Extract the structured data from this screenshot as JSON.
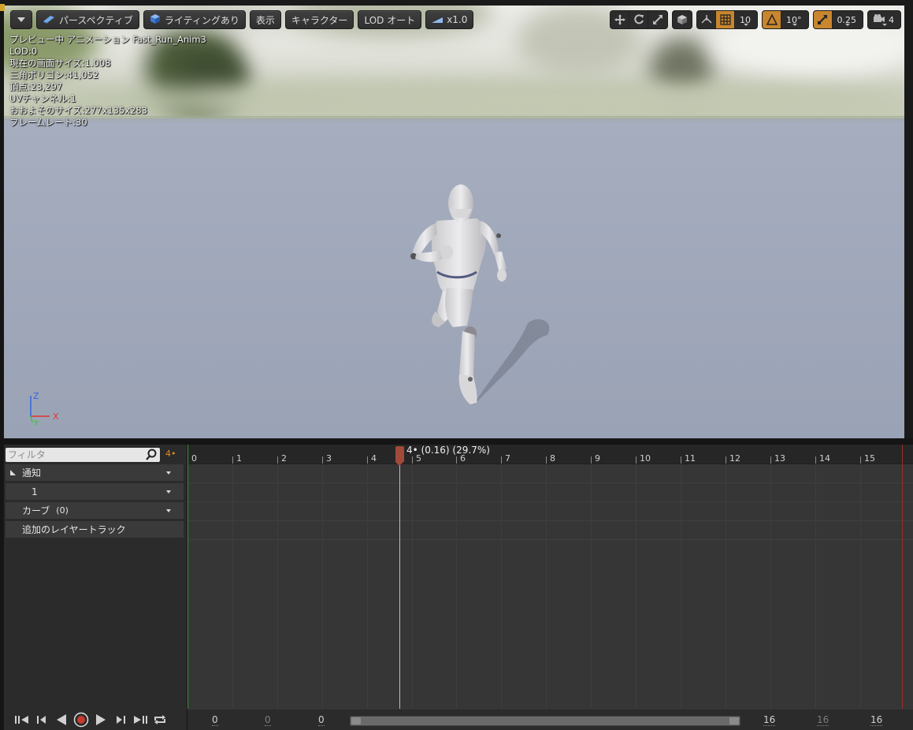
{
  "viewport": {
    "toolbar": {
      "menu_caret": "chevron-down-icon",
      "perspective_label": "パースペクティブ",
      "lighting_label": "ライティングあり",
      "show_label": "表示",
      "character_label": "キャラクター",
      "lod_label": "LOD オート",
      "speed_label": "x1.0"
    },
    "toolbar_right": {
      "grid_snap_value": "10",
      "rotate_snap_value": "10°",
      "scale_snap_value": "0.25",
      "camera_speed_value": "4"
    },
    "stats": [
      "プレビュー中 アニメーション Fast_Run_Anim3",
      "LOD:0",
      "現在の画面サイズ:1.008",
      "三角ポリゴン:41,052",
      "頂点:23,297",
      "UVチャンネル:1",
      "おおよそのサイズ:277x135x283",
      "フレームレート:30"
    ],
    "axis": {
      "x": "X",
      "y": "Y",
      "z": "Z"
    },
    "colors": {
      "x_axis": "#e0342c",
      "y_axis": "#3cc23c",
      "z_axis": "#3466e0"
    }
  },
  "tracks_panel": {
    "filter_placeholder": "フィルタ",
    "frame_indicator": "4•",
    "rows": [
      {
        "label": "通知"
      },
      {
        "label": "1"
      },
      {
        "label": "カーブ",
        "count": "(0)"
      },
      {
        "label": "追加のレイヤートラック"
      }
    ]
  },
  "timeline": {
    "tick_labels": [
      "0",
      "1",
      "2",
      "3",
      "4",
      "5",
      "6",
      "7",
      "8",
      "9",
      "10",
      "11",
      "12",
      "13",
      "14",
      "15"
    ],
    "playhead_label": "4• (0.16) (29.7%)"
  },
  "bottom_bar": {
    "start_values": [
      "0",
      "0",
      "0"
    ],
    "end_values": [
      "16",
      "16",
      "16"
    ]
  },
  "colors": {
    "accent": "#c8862e",
    "playhead": "#a14a3a",
    "start_marker": "#2ea12e",
    "end_marker": "#a12b2b"
  }
}
